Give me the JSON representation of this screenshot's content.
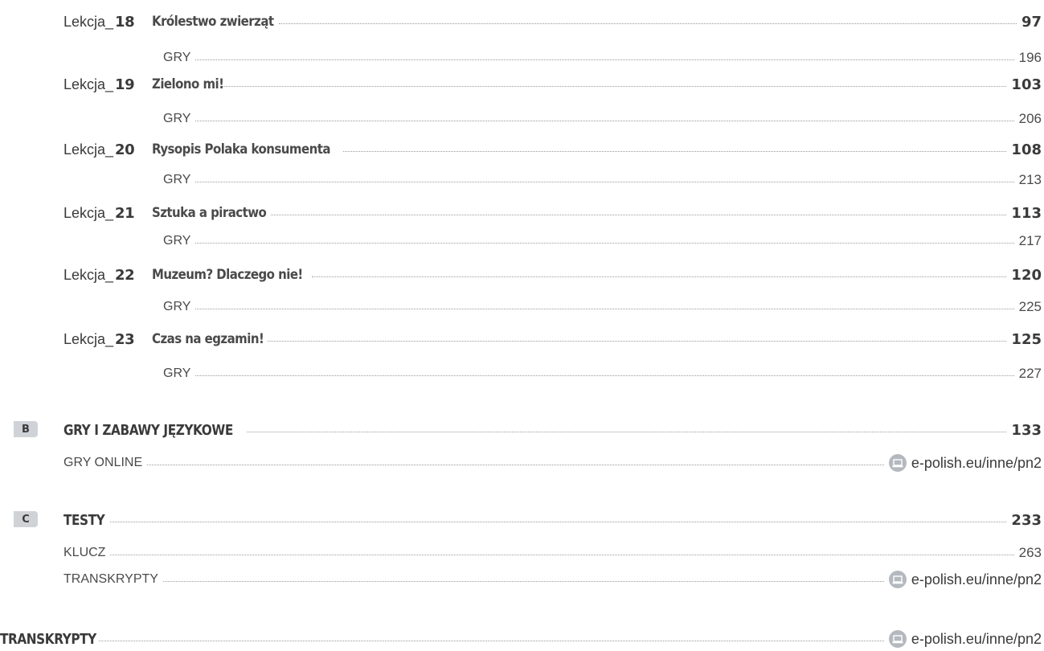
{
  "lessons": [
    {
      "prefix": "Lekcja_",
      "number": "18",
      "title": "Królestwo zwierząt",
      "page": "97",
      "games_label": "GRY",
      "games_page": "196"
    },
    {
      "prefix": "Lekcja_",
      "number": "19",
      "title": "Zielono mi!",
      "page": "103",
      "games_label": "GRY",
      "games_page": "206"
    },
    {
      "prefix": "Lekcja_",
      "number": "20",
      "title": "Rysopis Polaka konsumenta",
      "page": "108",
      "games_label": "GRY",
      "games_page": "213"
    },
    {
      "prefix": "Lekcja_",
      "number": "21",
      "title": "Sztuka a piractwo",
      "page": "113",
      "games_label": "GRY",
      "games_page": "217"
    },
    {
      "prefix": "Lekcja_",
      "number": "22",
      "title": "Muzeum? Dlaczego nie!",
      "page": "120",
      "games_label": "GRY",
      "games_page": "225"
    },
    {
      "prefix": "Lekcja_",
      "number": "23",
      "title": "Czas na egzamin!",
      "page": "125",
      "games_label": "GRY",
      "games_page": "227"
    }
  ],
  "section_b": {
    "tag": "B",
    "title": "GRY I ZABAWY JĘZYKOWE",
    "page": "133",
    "sub": {
      "label": "GRY ONLINE",
      "link": "e-polish.eu/inne/pn2",
      "icon": "laptop-icon"
    }
  },
  "section_c": {
    "tag": "C",
    "title": "TESTY",
    "page": "233",
    "subs": [
      {
        "label": "KLUCZ",
        "page": "263"
      },
      {
        "label": "TRANSKRYPTY",
        "link": "e-polish.eu/inne/pn2",
        "icon": "laptop-icon"
      }
    ]
  },
  "transcripts": {
    "title": "TRANSKRYPTY",
    "link": "e-polish.eu/inne/pn2",
    "icon": "laptop-icon"
  },
  "colors": {
    "text": "#3a3a3a",
    "tag_bg": "#cfd3d8",
    "leader": "#9a9a9a",
    "icon_bg": "#b4b9bf"
  }
}
